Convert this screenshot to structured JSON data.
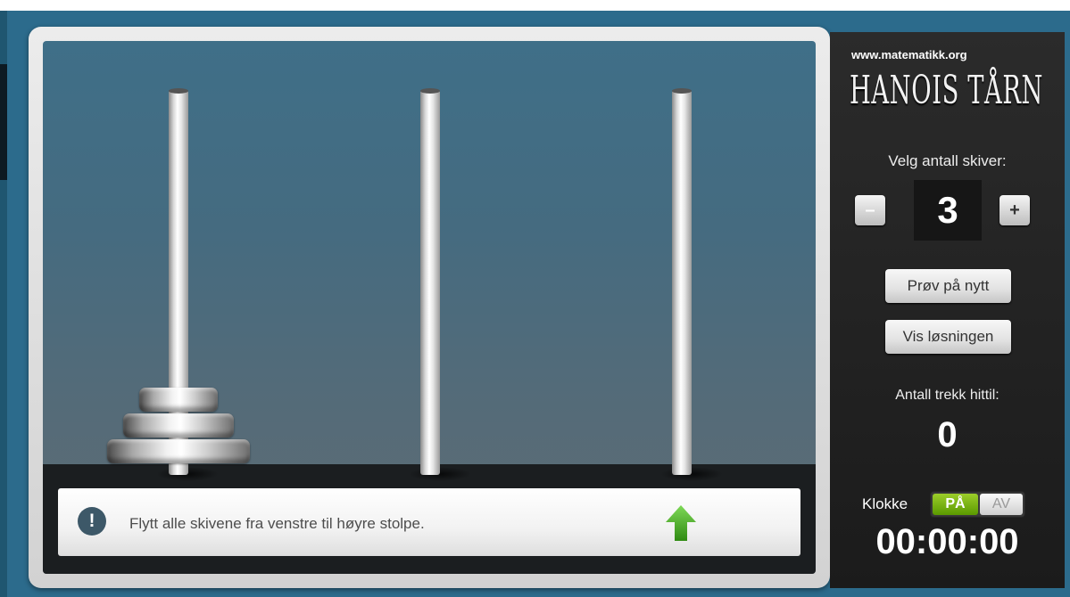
{
  "game": {
    "pegs": [
      {
        "name": "left",
        "disks": [
          3,
          2,
          1
        ]
      },
      {
        "name": "middle",
        "disks": []
      },
      {
        "name": "right",
        "disks": []
      }
    ],
    "message": "Flytt alle skivene fra venstre til høyre stolpe.",
    "message_icon": "info-icon",
    "action_icon": "up-arrow-icon"
  },
  "panel": {
    "site": "www.matematikk.org",
    "logo": "HANOIS TÅRN",
    "choose_label": "Velg antall skiver:",
    "minus_label": "–",
    "plus_label": "+",
    "disk_count": "3",
    "retry_button": "Prøv på nytt",
    "solution_button": "Vis løsningen",
    "moves_label": "Antall trekk hittil:",
    "moves": "0",
    "clock_label": "Klokke",
    "clock_on": "PÅ",
    "clock_off": "AV",
    "clock_state": "on",
    "time": "00:00:00"
  },
  "colors": {
    "background": "#2c6b8c",
    "toggle_on": "#7fbf1a",
    "arrow": "#4cae1f"
  }
}
